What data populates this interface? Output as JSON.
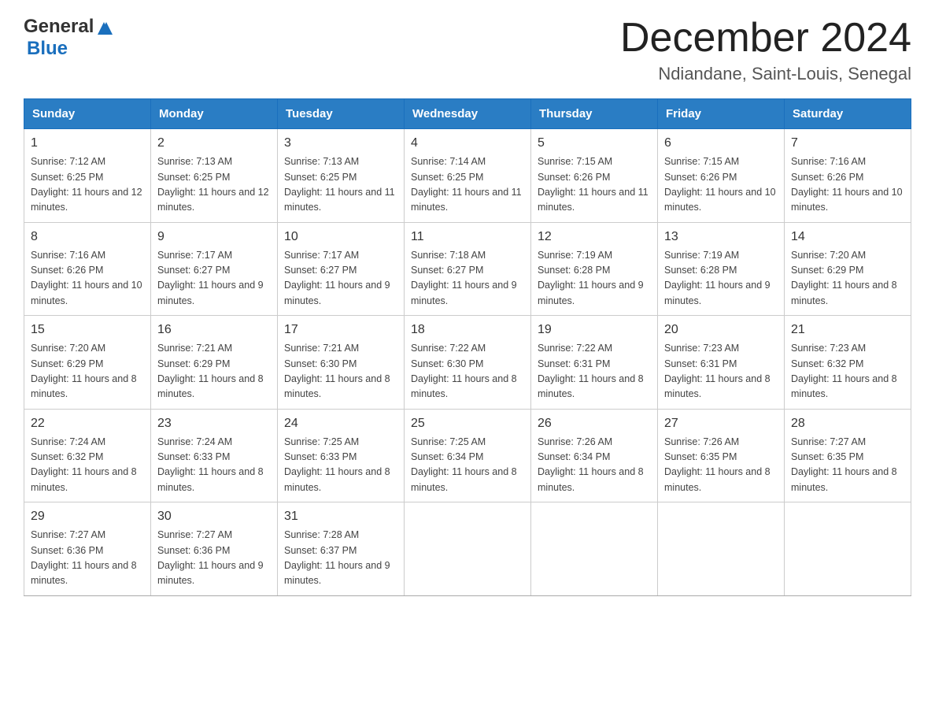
{
  "header": {
    "logo_general": "General",
    "logo_blue": "Blue",
    "title": "December 2024",
    "subtitle": "Ndiandane, Saint-Louis, Senegal"
  },
  "days_of_week": [
    "Sunday",
    "Monday",
    "Tuesday",
    "Wednesday",
    "Thursday",
    "Friday",
    "Saturday"
  ],
  "weeks": [
    [
      {
        "day": "1",
        "sunrise": "7:12 AM",
        "sunset": "6:25 PM",
        "daylight": "11 hours and 12 minutes."
      },
      {
        "day": "2",
        "sunrise": "7:13 AM",
        "sunset": "6:25 PM",
        "daylight": "11 hours and 12 minutes."
      },
      {
        "day": "3",
        "sunrise": "7:13 AM",
        "sunset": "6:25 PM",
        "daylight": "11 hours and 11 minutes."
      },
      {
        "day": "4",
        "sunrise": "7:14 AM",
        "sunset": "6:25 PM",
        "daylight": "11 hours and 11 minutes."
      },
      {
        "day": "5",
        "sunrise": "7:15 AM",
        "sunset": "6:26 PM",
        "daylight": "11 hours and 11 minutes."
      },
      {
        "day": "6",
        "sunrise": "7:15 AM",
        "sunset": "6:26 PM",
        "daylight": "11 hours and 10 minutes."
      },
      {
        "day": "7",
        "sunrise": "7:16 AM",
        "sunset": "6:26 PM",
        "daylight": "11 hours and 10 minutes."
      }
    ],
    [
      {
        "day": "8",
        "sunrise": "7:16 AM",
        "sunset": "6:26 PM",
        "daylight": "11 hours and 10 minutes."
      },
      {
        "day": "9",
        "sunrise": "7:17 AM",
        "sunset": "6:27 PM",
        "daylight": "11 hours and 9 minutes."
      },
      {
        "day": "10",
        "sunrise": "7:17 AM",
        "sunset": "6:27 PM",
        "daylight": "11 hours and 9 minutes."
      },
      {
        "day": "11",
        "sunrise": "7:18 AM",
        "sunset": "6:27 PM",
        "daylight": "11 hours and 9 minutes."
      },
      {
        "day": "12",
        "sunrise": "7:19 AM",
        "sunset": "6:28 PM",
        "daylight": "11 hours and 9 minutes."
      },
      {
        "day": "13",
        "sunrise": "7:19 AM",
        "sunset": "6:28 PM",
        "daylight": "11 hours and 9 minutes."
      },
      {
        "day": "14",
        "sunrise": "7:20 AM",
        "sunset": "6:29 PM",
        "daylight": "11 hours and 8 minutes."
      }
    ],
    [
      {
        "day": "15",
        "sunrise": "7:20 AM",
        "sunset": "6:29 PM",
        "daylight": "11 hours and 8 minutes."
      },
      {
        "day": "16",
        "sunrise": "7:21 AM",
        "sunset": "6:29 PM",
        "daylight": "11 hours and 8 minutes."
      },
      {
        "day": "17",
        "sunrise": "7:21 AM",
        "sunset": "6:30 PM",
        "daylight": "11 hours and 8 minutes."
      },
      {
        "day": "18",
        "sunrise": "7:22 AM",
        "sunset": "6:30 PM",
        "daylight": "11 hours and 8 minutes."
      },
      {
        "day": "19",
        "sunrise": "7:22 AM",
        "sunset": "6:31 PM",
        "daylight": "11 hours and 8 minutes."
      },
      {
        "day": "20",
        "sunrise": "7:23 AM",
        "sunset": "6:31 PM",
        "daylight": "11 hours and 8 minutes."
      },
      {
        "day": "21",
        "sunrise": "7:23 AM",
        "sunset": "6:32 PM",
        "daylight": "11 hours and 8 minutes."
      }
    ],
    [
      {
        "day": "22",
        "sunrise": "7:24 AM",
        "sunset": "6:32 PM",
        "daylight": "11 hours and 8 minutes."
      },
      {
        "day": "23",
        "sunrise": "7:24 AM",
        "sunset": "6:33 PM",
        "daylight": "11 hours and 8 minutes."
      },
      {
        "day": "24",
        "sunrise": "7:25 AM",
        "sunset": "6:33 PM",
        "daylight": "11 hours and 8 minutes."
      },
      {
        "day": "25",
        "sunrise": "7:25 AM",
        "sunset": "6:34 PM",
        "daylight": "11 hours and 8 minutes."
      },
      {
        "day": "26",
        "sunrise": "7:26 AM",
        "sunset": "6:34 PM",
        "daylight": "11 hours and 8 minutes."
      },
      {
        "day": "27",
        "sunrise": "7:26 AM",
        "sunset": "6:35 PM",
        "daylight": "11 hours and 8 minutes."
      },
      {
        "day": "28",
        "sunrise": "7:27 AM",
        "sunset": "6:35 PM",
        "daylight": "11 hours and 8 minutes."
      }
    ],
    [
      {
        "day": "29",
        "sunrise": "7:27 AM",
        "sunset": "6:36 PM",
        "daylight": "11 hours and 8 minutes."
      },
      {
        "day": "30",
        "sunrise": "7:27 AM",
        "sunset": "6:36 PM",
        "daylight": "11 hours and 9 minutes."
      },
      {
        "day": "31",
        "sunrise": "7:28 AM",
        "sunset": "6:37 PM",
        "daylight": "11 hours and 9 minutes."
      },
      null,
      null,
      null,
      null
    ]
  ],
  "label_sunrise": "Sunrise:",
  "label_sunset": "Sunset:",
  "label_daylight": "Daylight:"
}
